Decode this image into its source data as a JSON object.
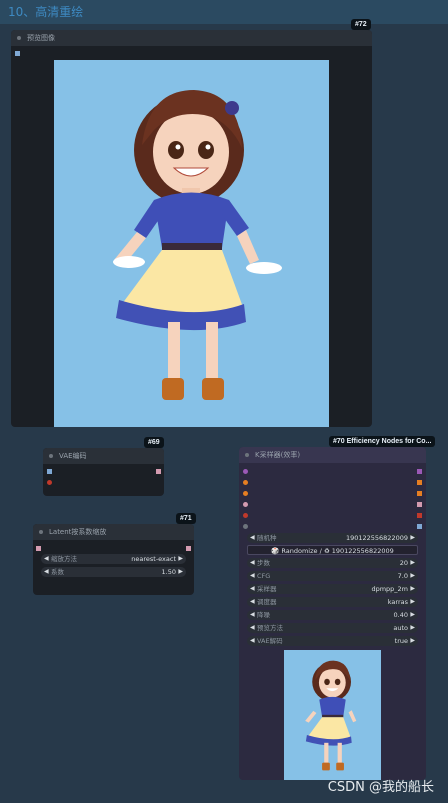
{
  "group": {
    "title": "10、高清重绘"
  },
  "preview_node": {
    "badge": "#72",
    "title": "预览图像"
  },
  "vae_node": {
    "badge": "#69",
    "title": "VAE编码"
  },
  "latent_node": {
    "badge": "#71",
    "title": "Latent按系数缩放",
    "widgets": [
      {
        "label": "缩放方法",
        "value": "nearest-exact"
      },
      {
        "label": "系数",
        "value": "1.50"
      }
    ]
  },
  "ksampler_node": {
    "badge": "#70 Efficiency Nodes for Co...",
    "title": "K采样器(效率)",
    "seed": {
      "label": "随机种",
      "value": "190122556822009"
    },
    "randomize_label": "🎲 Randomize / ♻ 190122556822009",
    "widgets": [
      {
        "label": "步数",
        "value": "20"
      },
      {
        "label": "CFG",
        "value": "7.0"
      },
      {
        "label": "采样器",
        "value": "dpmpp_2m"
      },
      {
        "label": "调度器",
        "value": "karras"
      },
      {
        "label": "降噪",
        "value": "0.40"
      },
      {
        "label": "预览方法",
        "value": "auto"
      },
      {
        "label": "VAE解码",
        "value": "true"
      }
    ]
  },
  "watermark": "CSDN @我的船长",
  "colors": {
    "group_header": "#2b4a61",
    "group_body": "#27394a",
    "node_bg": "#1b1f25",
    "preview_bg": "#86c1e7"
  }
}
